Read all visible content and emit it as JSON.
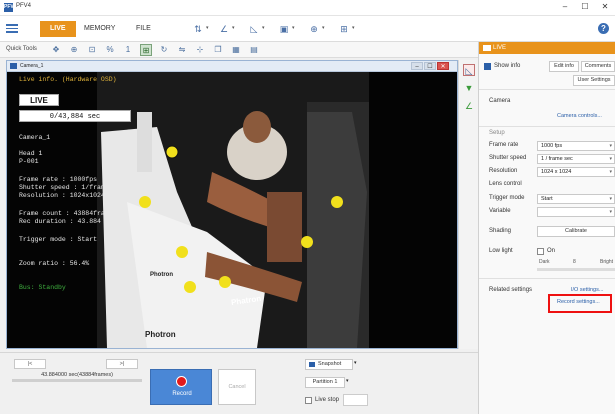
{
  "window": {
    "title": "PFV4",
    "logo_text": "PFV",
    "minimize": "–",
    "maximize": "☐",
    "close": "✕"
  },
  "ribbon": {
    "tabs": [
      {
        "label": "LIVE"
      },
      {
        "label": "MEMORY"
      },
      {
        "label": "FILE"
      }
    ],
    "help": "?"
  },
  "quick_tools": {
    "label": "Quick Tools"
  },
  "camera_window": {
    "title": "Camera_1",
    "overlay": {
      "header": "Live info. (Hardware OSD)",
      "live_badge": "LIVE",
      "time": "0/43,884 sec",
      "camera": "Camera_1",
      "head": "Head 1",
      "id": "P-001",
      "frame_rate": "Frame rate    : 1000fps",
      "shutter": "Shutter speed : 1/frame sec",
      "resolution": "Resolution    : 1024x1024",
      "frame_count": "Frame count   : 43884frames",
      "rec_duration": "Rec duration  : 43.884 sec",
      "trigger": "Trigger mode  : Start",
      "zoom": "Zoom ratio    : 56.4%",
      "bus": "Bus:          Standby"
    },
    "scene": {
      "logo1": "Photron",
      "logo2": "Photron",
      "logo3": "Phatron"
    }
  },
  "right_panel": {
    "header": "LIVE",
    "show_info": "Show info",
    "edit_info": "Edit info",
    "comments": "Comments",
    "user_settings": "User Settings",
    "camera_section": "Camera",
    "camera_controls": "Camera controls...",
    "setup_section": "Setup",
    "frame_rate_label": "Frame rate",
    "frame_rate_value": "1000 fps",
    "shutter_label": "Shutter speed",
    "shutter_value": "1 / frame sec",
    "resolution_label": "Resolution",
    "resolution_value": "1024 x 1024",
    "lens_control": "Lens control",
    "trigger_label": "Trigger mode",
    "trigger_value": "Start",
    "variable_label": "Variable",
    "variable_value": "",
    "shading_label": "Shading",
    "calibrate": "Calibrate",
    "low_light_label": "Low light",
    "low_light_on": "On",
    "dark": "Dark",
    "bright": "Bright",
    "low_light_level": "8",
    "related_settings": "Related settings",
    "io_settings": "I/O settings...",
    "record_settings": "Record settings..."
  },
  "bottom": {
    "btn_left1": "|<",
    "btn_left2": ">|",
    "position": "43.884000 sec(43884frames)",
    "record": "Record",
    "cancel": "Cancel",
    "snapshot": "Snapshot",
    "partition": "Partition 1",
    "live_stop": "Live stop"
  },
  "icons": [
    "menu-icon",
    "zoom-icon",
    "hand-icon",
    "crop-icon",
    "rotate-icon",
    "camera-icon",
    "filter-icon",
    "chart-icon"
  ]
}
